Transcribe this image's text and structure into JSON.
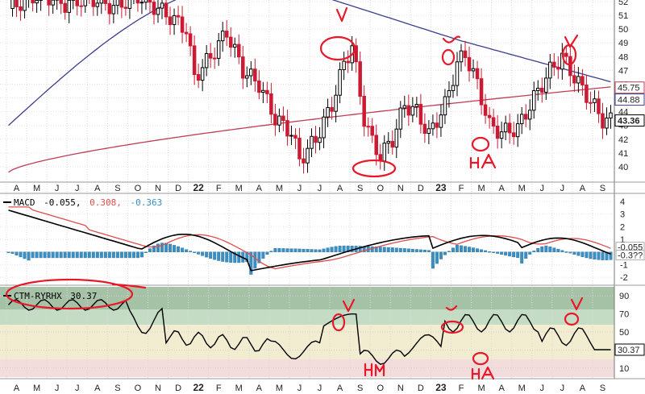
{
  "chart_data": [
    {
      "type": "candlestick",
      "panel": "price",
      "ylim": [
        39,
        52
      ],
      "yticks": [
        40,
        41,
        42,
        43,
        44,
        45,
        46,
        47,
        48,
        49,
        50,
        51,
        52
      ],
      "x_labels": [
        "A",
        "M",
        "J",
        "J",
        "A",
        "S",
        "O",
        "N",
        "D",
        "22",
        "F",
        "M",
        "A",
        "M",
        "J",
        "J",
        "A",
        "S",
        "O",
        "N",
        "D",
        "23",
        "F",
        "M",
        "A",
        "M",
        "J",
        "J",
        "A",
        "S"
      ],
      "bold_labels": [
        "22",
        "23"
      ],
      "price_tags": [
        {
          "label": "45.75",
          "value": 45.75,
          "color": "#c03c55"
        },
        {
          "label": "44.88",
          "value": 44.88,
          "color": "#3d3d8f"
        },
        {
          "label": "43.36",
          "value": 43.36,
          "color": "#000000",
          "bold": true
        }
      ],
      "ma_long_color": "#3d3d8f",
      "ma_short_color": "#c03c55",
      "candle_up_color": "#000000",
      "candle_down_color": "#cc1a33",
      "grid": true
    },
    {
      "type": "line",
      "panel": "macd",
      "title": "MACD(12,26,9)",
      "values_text": [
        "-0.055,",
        "0.308,",
        "-0.363"
      ],
      "colors": {
        "macd": "#000000",
        "signal": "#e04c4c",
        "histogram": "#3a8fc4"
      },
      "ylim": [
        -2.5,
        4.5
      ],
      "yticks": [
        4,
        3,
        2,
        1,
        0,
        -1,
        -2
      ],
      "tags": [
        {
          "label": "-0.055"
        },
        {
          "label": "-0.3??"
        }
      ],
      "grid": true
    },
    {
      "type": "line",
      "panel": "oscillator",
      "title": "CTM-RYRHX",
      "value_text": "30.37",
      "ylim": [
        0,
        100
      ],
      "yticks": [
        90,
        70,
        50,
        30,
        10
      ],
      "tag": "30.37",
      "bands": [
        {
          "from": 75,
          "to": 100,
          "color": "#a6c2a6"
        },
        {
          "from": 58,
          "to": 75,
          "color": "#c3dcc3"
        },
        {
          "from": 20,
          "to": 58,
          "color": "#f2edd0"
        },
        {
          "from": 0,
          "to": 20,
          "color": "#f3dcdc"
        }
      ],
      "grid": true
    }
  ],
  "annotations": {
    "color": "#e8182a",
    "handwritten_marks": [
      "V",
      "V",
      "V",
      "V",
      "V",
      "V",
      "HA",
      "HM",
      "HA"
    ]
  }
}
